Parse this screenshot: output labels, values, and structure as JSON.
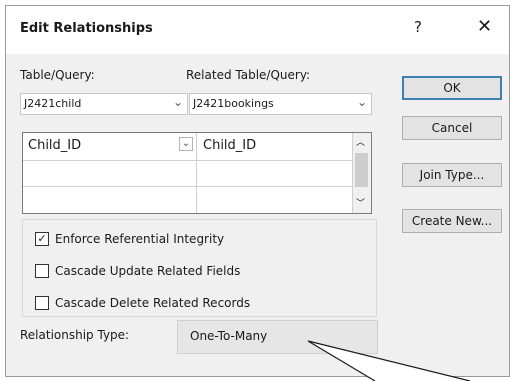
{
  "dialog": {
    "title": "Edit Relationships",
    "help_icon": "?",
    "close_icon": "✕"
  },
  "table_query": {
    "label": "Table/Query:",
    "value": "J2421child"
  },
  "related_table_query": {
    "label": "Related Table/Query:",
    "value": "J2421bookings"
  },
  "fields_grid": {
    "rows": [
      {
        "left": "Child_ID",
        "right": "Child_ID"
      },
      {
        "left": "",
        "right": ""
      },
      {
        "left": "",
        "right": ""
      }
    ]
  },
  "options": {
    "enforce_integrity": {
      "label": "Enforce Referential Integrity",
      "checked": true
    },
    "cascade_update": {
      "label": "Cascade Update Related Fields",
      "checked": false
    },
    "cascade_delete": {
      "label": "Cascade Delete Related Records",
      "checked": false
    }
  },
  "relationship_type": {
    "label": "Relationship Type:",
    "value": "One-To-Many"
  },
  "buttons": {
    "ok": "OK",
    "cancel": "Cancel",
    "join_type": "Join Type...",
    "create_new": "Create New..."
  }
}
